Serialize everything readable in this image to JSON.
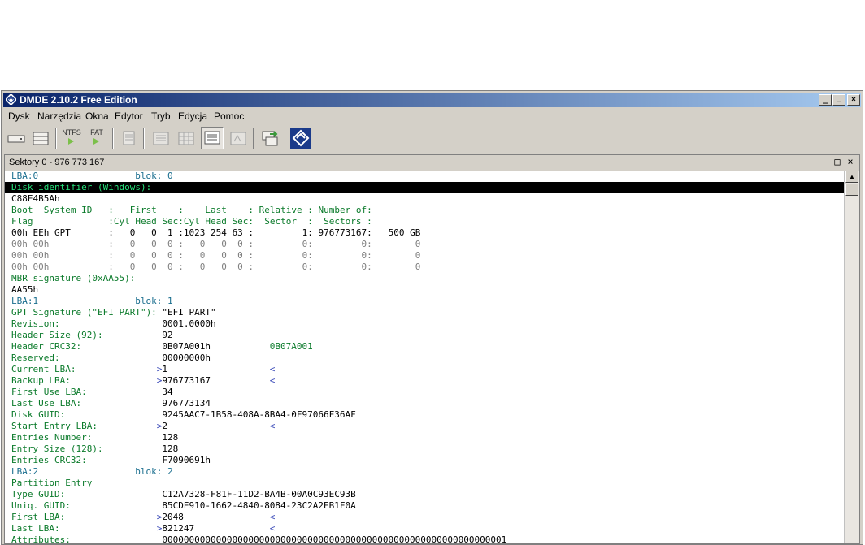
{
  "window": {
    "title": "DMDE 2.10.2 Free Edition",
    "controls": {
      "minimize": "_",
      "maximize": "□",
      "close": "×"
    }
  },
  "menu": [
    "Dysk",
    "Narzędzia",
    "Okna",
    "Edytor",
    "Tryb",
    "Edycja",
    "Pomoc"
  ],
  "toolbar": {
    "ntfs_label": "NTFS",
    "fat_label": "FAT",
    "icons": [
      "drive-icon",
      "partitions-icon",
      "ntfs-open-icon",
      "fat-open-icon",
      "document-icon",
      "hex-view-icon",
      "table-view-icon",
      "text-view-icon",
      "template-icon",
      "copy-sectors-icon",
      "dmde-logo-icon"
    ]
  },
  "panel": {
    "title": "Sektory 0 - 976 773 167",
    "maximize": "□",
    "close": "×"
  },
  "lines": [
    {
      "segs": [
        {
          "t": "LBA:0",
          "x": 0,
          "c": "b"
        },
        {
          "t": "blok: 0",
          "x": 23,
          "c": "b"
        }
      ]
    },
    {
      "hl": true,
      "segs": [
        {
          "t": "Disk identifier (Windows):",
          "x": 0,
          "c": "g"
        }
      ]
    },
    {
      "segs": [
        {
          "t": "C88E4B5Ah",
          "x": 0,
          "c": "k"
        }
      ]
    },
    {
      "segs": [
        {
          "t": "Boot  System ID   :   First    :    Last    : Relative : Number of:",
          "x": 0,
          "c": "g"
        }
      ]
    },
    {
      "segs": [
        {
          "t": "Flag              :Cyl Head Sec:Cyl Head Sec:  Sector  :  Sectors :",
          "x": 0,
          "c": "g"
        }
      ]
    },
    {
      "segs": [
        {
          "t": "00h EEh GPT       :   0   0  1 :1023 254 63 :         1: 976773167:   500 GB",
          "x": 0,
          "c": "k"
        }
      ]
    },
    {
      "segs": [
        {
          "t": "00h 00h           :   0   0  0 :   0   0  0 :         0:         0:        0",
          "x": 0,
          "c": "gr"
        }
      ]
    },
    {
      "segs": [
        {
          "t": "00h 00h           :   0   0  0 :   0   0  0 :         0:         0:        0",
          "x": 0,
          "c": "gr"
        }
      ]
    },
    {
      "segs": [
        {
          "t": "00h 00h           :   0   0  0 :   0   0  0 :         0:         0:        0",
          "x": 0,
          "c": "gr"
        }
      ]
    },
    {
      "segs": [
        {
          "t": "MBR signature (0xAA55):",
          "x": 0,
          "c": "g"
        }
      ]
    },
    {
      "segs": [
        {
          "t": "AA55h",
          "x": 0,
          "c": "k"
        }
      ]
    },
    {
      "segs": [
        {
          "t": "LBA:1",
          "x": 0,
          "c": "b"
        },
        {
          "t": "blok: 1",
          "x": 23,
          "c": "b"
        }
      ]
    },
    {
      "segs": [
        {
          "t": "GPT Signature (\"EFI PART\"):",
          "x": 0,
          "c": "g"
        },
        {
          "t": "\"EFI PART\"",
          "x": 28,
          "c": "k"
        }
      ]
    },
    {
      "segs": [
        {
          "t": "Revision:",
          "x": 0,
          "c": "g"
        },
        {
          "t": "0001.0000h",
          "x": 28,
          "c": "k"
        }
      ]
    },
    {
      "segs": [
        {
          "t": "Header Size (92):",
          "x": 0,
          "c": "g"
        },
        {
          "t": "92",
          "x": 28,
          "c": "k"
        }
      ]
    },
    {
      "segs": [
        {
          "t": "Header CRC32:",
          "x": 0,
          "c": "g"
        },
        {
          "t": "0B07A001h",
          "x": 28,
          "c": "k"
        },
        {
          "t": "0B07A001",
          "x": 48,
          "c": "g"
        }
      ]
    },
    {
      "segs": [
        {
          "t": "Reserved:",
          "x": 0,
          "c": "g"
        },
        {
          "t": "00000000h",
          "x": 28,
          "c": "k"
        }
      ]
    },
    {
      "segs": [
        {
          "t": "Current LBA:",
          "x": 0,
          "c": "g"
        },
        {
          "t": ">",
          "x": 27,
          "c": "bl"
        },
        {
          "t": "1",
          "x": 28,
          "c": "k"
        },
        {
          "t": "<",
          "x": 48,
          "c": "bl"
        }
      ]
    },
    {
      "segs": [
        {
          "t": "Backup LBA:",
          "x": 0,
          "c": "g"
        },
        {
          "t": ">",
          "x": 27,
          "c": "bl"
        },
        {
          "t": "976773167",
          "x": 28,
          "c": "k"
        },
        {
          "t": "<",
          "x": 48,
          "c": "bl"
        }
      ]
    },
    {
      "segs": [
        {
          "t": "First Use LBA:",
          "x": 0,
          "c": "g"
        },
        {
          "t": "34",
          "x": 28,
          "c": "k"
        }
      ]
    },
    {
      "segs": [
        {
          "t": "Last Use LBA:",
          "x": 0,
          "c": "g"
        },
        {
          "t": "976773134",
          "x": 28,
          "c": "k"
        }
      ]
    },
    {
      "segs": [
        {
          "t": "Disk GUID:",
          "x": 0,
          "c": "g"
        },
        {
          "t": "9245AAC7-1B58-408A-8BA4-0F97066F36AF",
          "x": 28,
          "c": "k"
        }
      ]
    },
    {
      "segs": [
        {
          "t": "Start Entry LBA:",
          "x": 0,
          "c": "g"
        },
        {
          "t": ">",
          "x": 27,
          "c": "bl"
        },
        {
          "t": "2",
          "x": 28,
          "c": "k"
        },
        {
          "t": "<",
          "x": 48,
          "c": "bl"
        }
      ]
    },
    {
      "segs": [
        {
          "t": "Entries Number:",
          "x": 0,
          "c": "g"
        },
        {
          "t": "128",
          "x": 28,
          "c": "k"
        }
      ]
    },
    {
      "segs": [
        {
          "t": "Entry Size (128):",
          "x": 0,
          "c": "g"
        },
        {
          "t": "128",
          "x": 28,
          "c": "k"
        }
      ]
    },
    {
      "segs": [
        {
          "t": "Entries CRC32:",
          "x": 0,
          "c": "g"
        },
        {
          "t": "F7090691h",
          "x": 28,
          "c": "k"
        }
      ]
    },
    {
      "segs": [
        {
          "t": "LBA:2",
          "x": 0,
          "c": "b"
        },
        {
          "t": "blok: 2",
          "x": 23,
          "c": "b"
        }
      ]
    },
    {
      "segs": [
        {
          "t": "Partition Entry",
          "x": 0,
          "c": "g"
        }
      ]
    },
    {
      "segs": [
        {
          "t": "Type GUID:",
          "x": 0,
          "c": "g"
        },
        {
          "t": "C12A7328-F81F-11D2-BA4B-00A0C93EC93B",
          "x": 28,
          "c": "k"
        }
      ]
    },
    {
      "segs": [
        {
          "t": "Uniq. GUID:",
          "x": 0,
          "c": "g"
        },
        {
          "t": "85CDE910-1662-4840-8084-23C2A2EB1F0A",
          "x": 28,
          "c": "k"
        }
      ]
    },
    {
      "segs": [
        {
          "t": "First LBA:",
          "x": 0,
          "c": "g"
        },
        {
          "t": ">",
          "x": 27,
          "c": "bl"
        },
        {
          "t": "2048",
          "x": 28,
          "c": "k"
        },
        {
          "t": "<",
          "x": 48,
          "c": "bl"
        }
      ]
    },
    {
      "segs": [
        {
          "t": "Last LBA:",
          "x": 0,
          "c": "g"
        },
        {
          "t": ">",
          "x": 27,
          "c": "bl"
        },
        {
          "t": "821247",
          "x": 28,
          "c": "k"
        },
        {
          "t": "<",
          "x": 48,
          "c": "bl"
        }
      ]
    },
    {
      "segs": [
        {
          "t": "Attributes:",
          "x": 0,
          "c": "g"
        },
        {
          "t": "0000000000000000000000000000000000000000000000000000000000000001",
          "x": 28,
          "c": "k"
        }
      ]
    }
  ]
}
